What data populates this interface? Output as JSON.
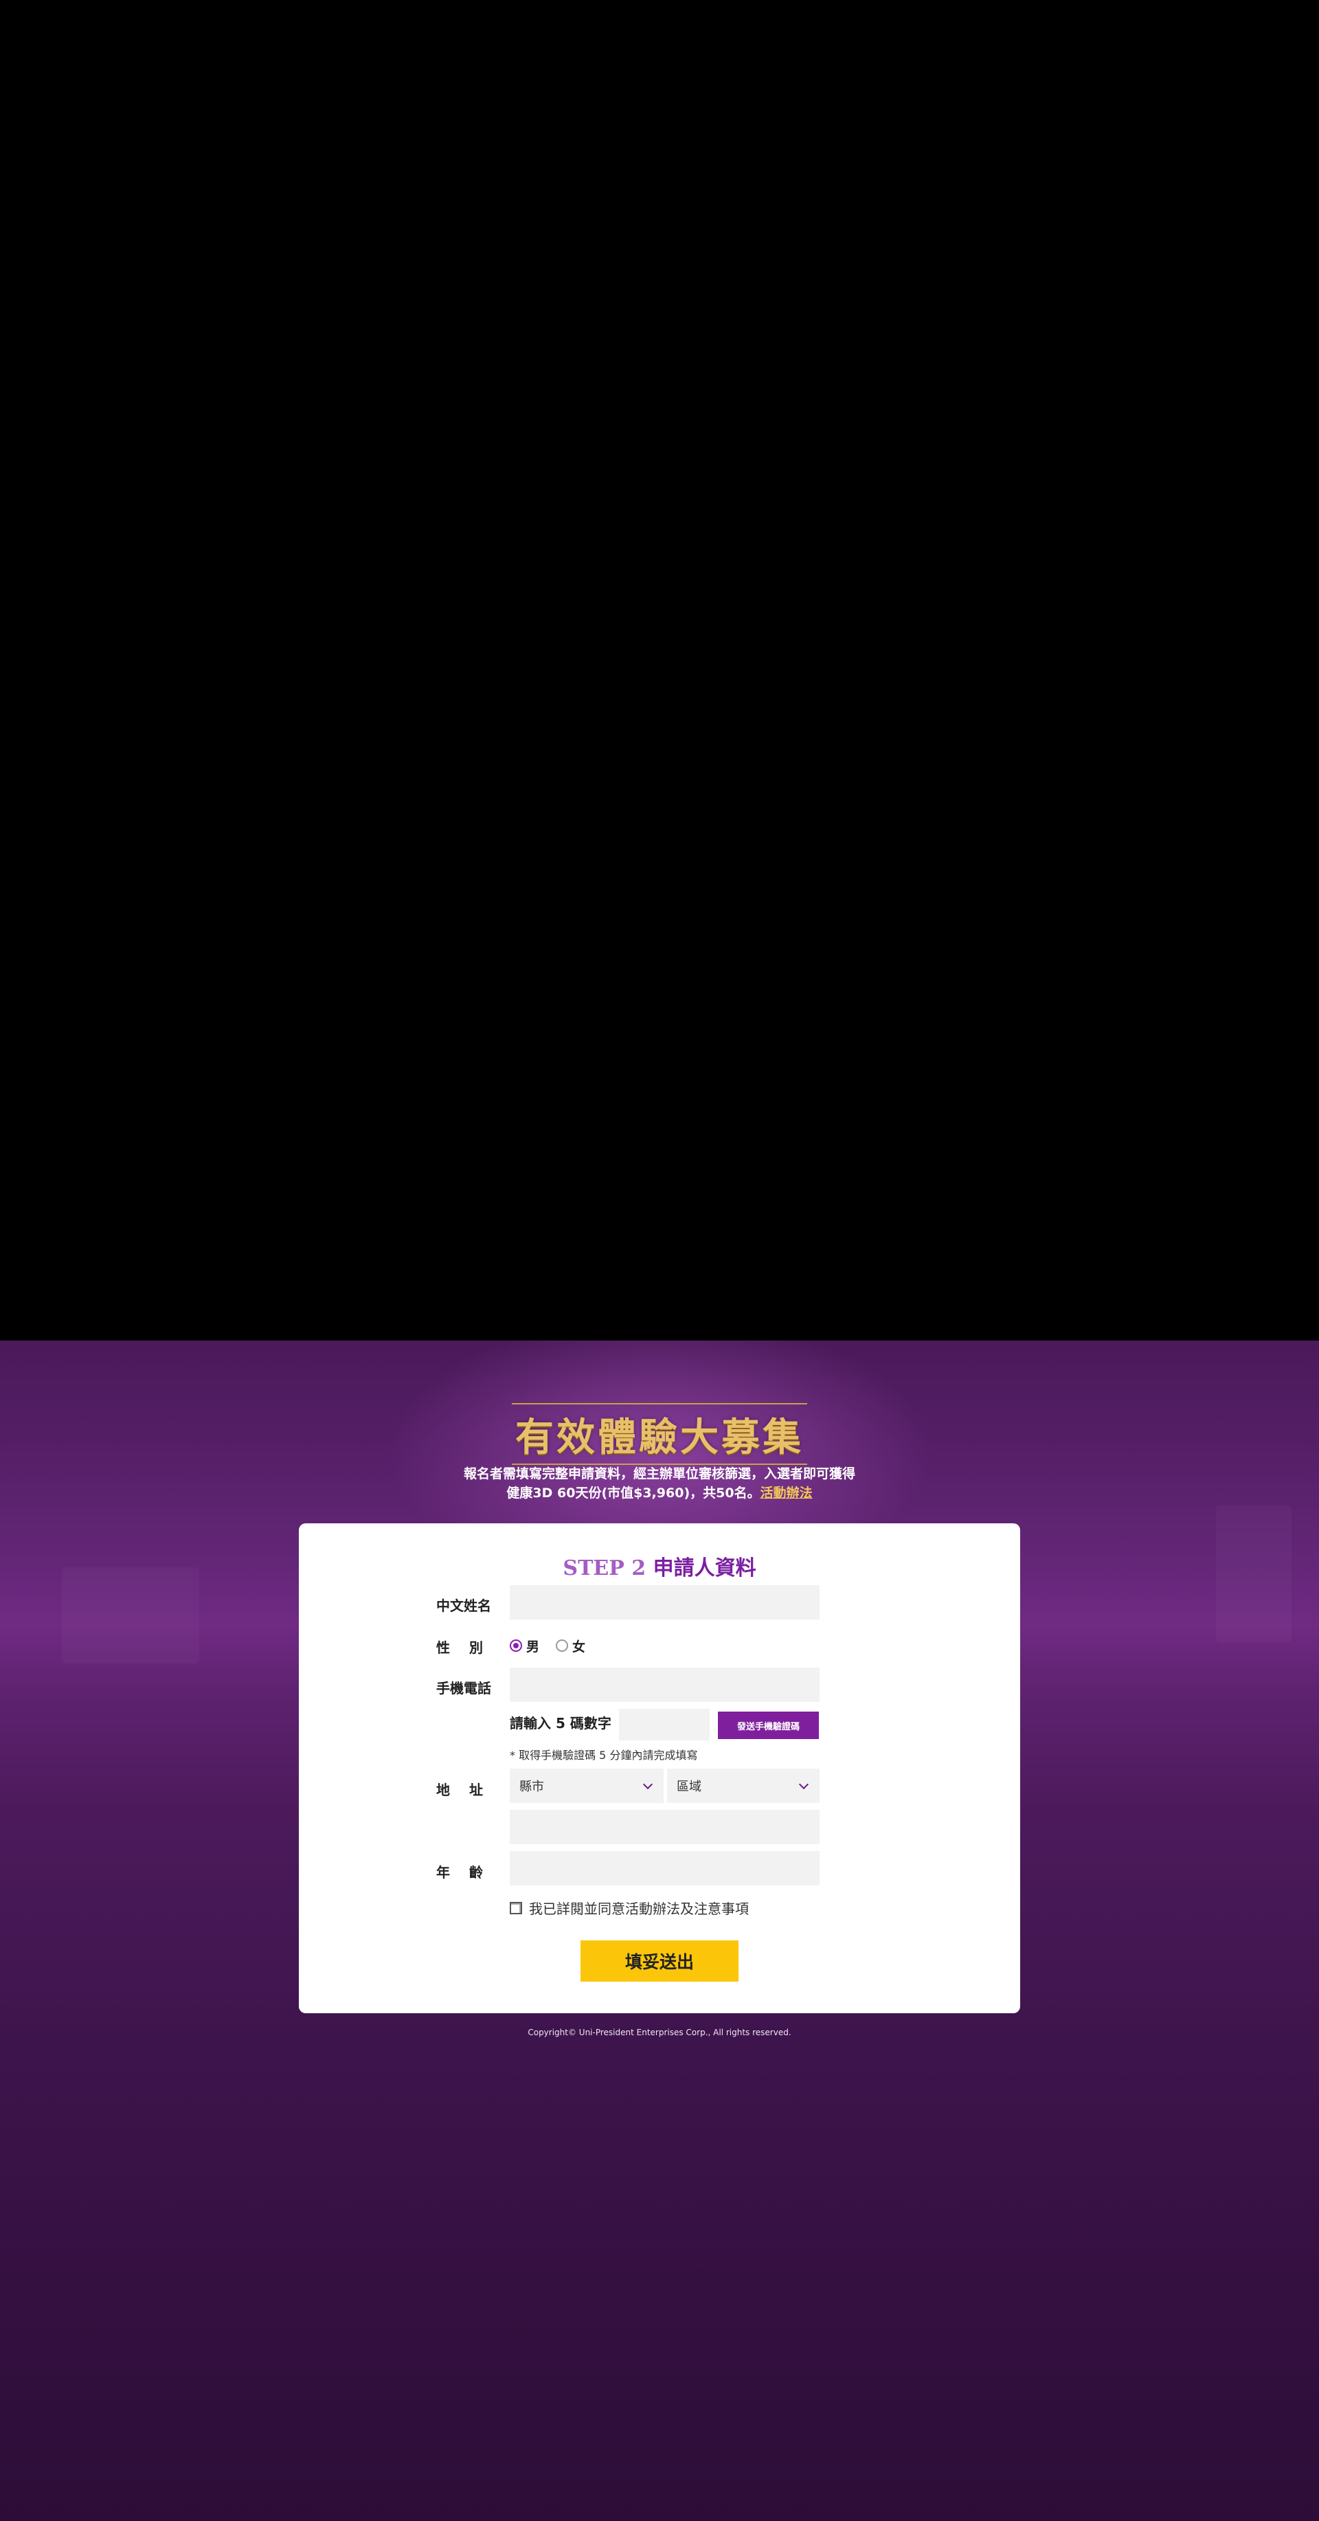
{
  "banner": {
    "title": "有效體驗大募集",
    "desc_line1": "報名者需填寫完整申請資料，經主辦單位審核篩選，入選者即可獲得",
    "desc_line2": "健康3D 60天份(市值$3,960)，共50名。",
    "rules_link": "活動辦法"
  },
  "form": {
    "step": "STEP 2",
    "title": "申請人資料",
    "name_label": "中文姓名",
    "gender_label": "性別",
    "gender_options": [
      "男",
      "女"
    ],
    "gender_selected": "男",
    "phone_label": "手機電話",
    "code_label": "請輸入 5 碼數字",
    "send_code_button": "發送手機驗證碼",
    "code_note": "* 取得手機驗證碼 5 分鐘內請完成填寫",
    "address_label": "地址",
    "city_select": "縣市",
    "district_select": "區域",
    "age_label": "年齡",
    "agree_text": "我已詳閱並同意活動辦法及注意事項",
    "submit_button": "填妥送出"
  },
  "footer": {
    "copyright": "Copyright© Uni-President Enterprises Corp., All rights reserved."
  },
  "colors": {
    "accent_purple": "#7f1f9e",
    "submit_yellow": "#fbc60a",
    "gold": "#e8c06a"
  }
}
